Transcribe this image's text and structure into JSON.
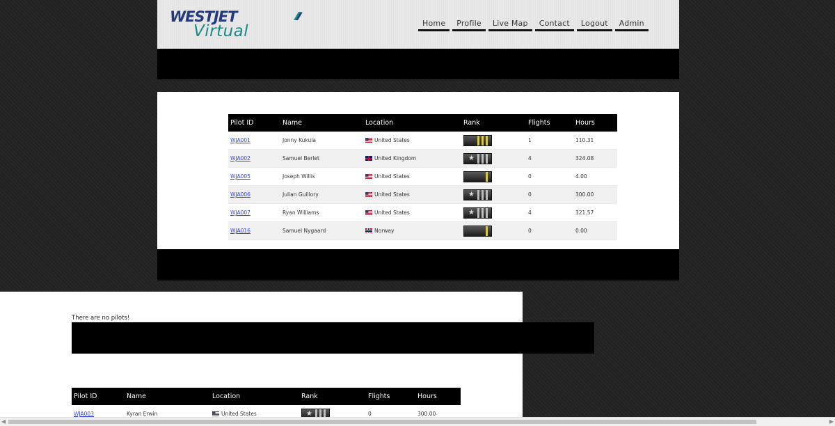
{
  "brand": {
    "line1": "WESTJET",
    "line2": "Virtual"
  },
  "nav": [
    "Home",
    "Profile",
    "Live Map",
    "Contact",
    "Logout",
    "Admin"
  ],
  "columns": [
    "Pilot ID",
    "Name",
    "Location",
    "Rank",
    "Flights",
    "Hours"
  ],
  "roster1": [
    {
      "id": "WJA001",
      "name": "Jonny Kukula",
      "flag": "us",
      "location": "United States",
      "rank_style": "gold",
      "rank_star": false,
      "rank_stripes": 3,
      "flights": "1",
      "hours": "110.31"
    },
    {
      "id": "WJA002",
      "name": "Samuel Berlet",
      "flag": "gb",
      "location": "United Kingdom",
      "rank_style": "silver",
      "rank_star": true,
      "rank_stripes": 3,
      "flights": "4",
      "hours": "324.08"
    },
    {
      "id": "WJA005",
      "name": "Joseph Willis",
      "flag": "us",
      "location": "United States",
      "rank_style": "gold",
      "rank_star": false,
      "rank_stripes": 1,
      "flights": "0",
      "hours": "4.00"
    },
    {
      "id": "WJA006",
      "name": "Julian Guillory",
      "flag": "us",
      "location": "United States",
      "rank_style": "silver",
      "rank_star": true,
      "rank_stripes": 3,
      "flights": "0",
      "hours": "300.00"
    },
    {
      "id": "WJA007",
      "name": "Ryan Williams",
      "flag": "us",
      "location": "United States",
      "rank_style": "silver",
      "rank_star": true,
      "rank_stripes": 3,
      "flights": "4",
      "hours": "321.57"
    },
    {
      "id": "WJA016",
      "name": "Samuel Nygaard",
      "flag": "no",
      "location": "Norway",
      "rank_style": "gold",
      "rank_star": false,
      "rank_stripes": 1,
      "flights": "0",
      "hours": "0.00"
    }
  ],
  "empty_message": "There are no pilots!",
  "roster2": [
    {
      "id": "WJA003",
      "name": "Kyran Erwin",
      "flag": "us",
      "location": "United States",
      "rank_style": "silver",
      "rank_star": true,
      "rank_stripes": 3,
      "flights": "0",
      "hours": "300.00"
    }
  ],
  "colors": {
    "brand_navy": "#243a7a",
    "brand_teal": "#1a8a86",
    "link": "#3344dd"
  }
}
